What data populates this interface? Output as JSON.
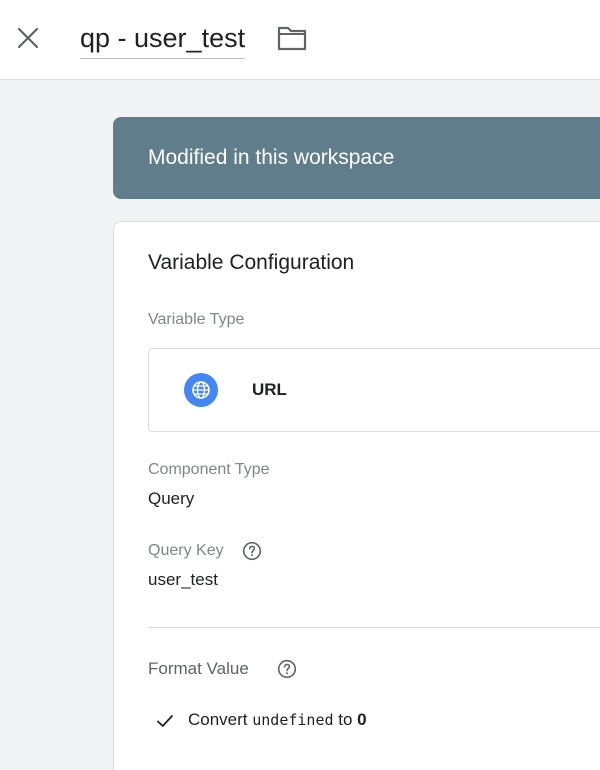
{
  "header": {
    "title": "qp - user_test",
    "close_icon": "close-icon",
    "folder_icon": "folder-icon"
  },
  "banner": {
    "text": "Modified in this workspace",
    "color": "#607d8b"
  },
  "config": {
    "title": "Variable Configuration",
    "variable_type_label": "Variable Type",
    "variable_type_value": "URL",
    "variable_type_icon": "globe-icon",
    "component_type_label": "Component Type",
    "component_type_value": "Query",
    "query_key_label": "Query Key",
    "query_key_value": "user_test",
    "format_value_label": "Format Value",
    "convert": {
      "prefix": "Convert ",
      "code": "undefined",
      "middle": " to ",
      "value": "0"
    }
  },
  "colors": {
    "accent": "#4285f4",
    "banner": "#607d8b"
  }
}
